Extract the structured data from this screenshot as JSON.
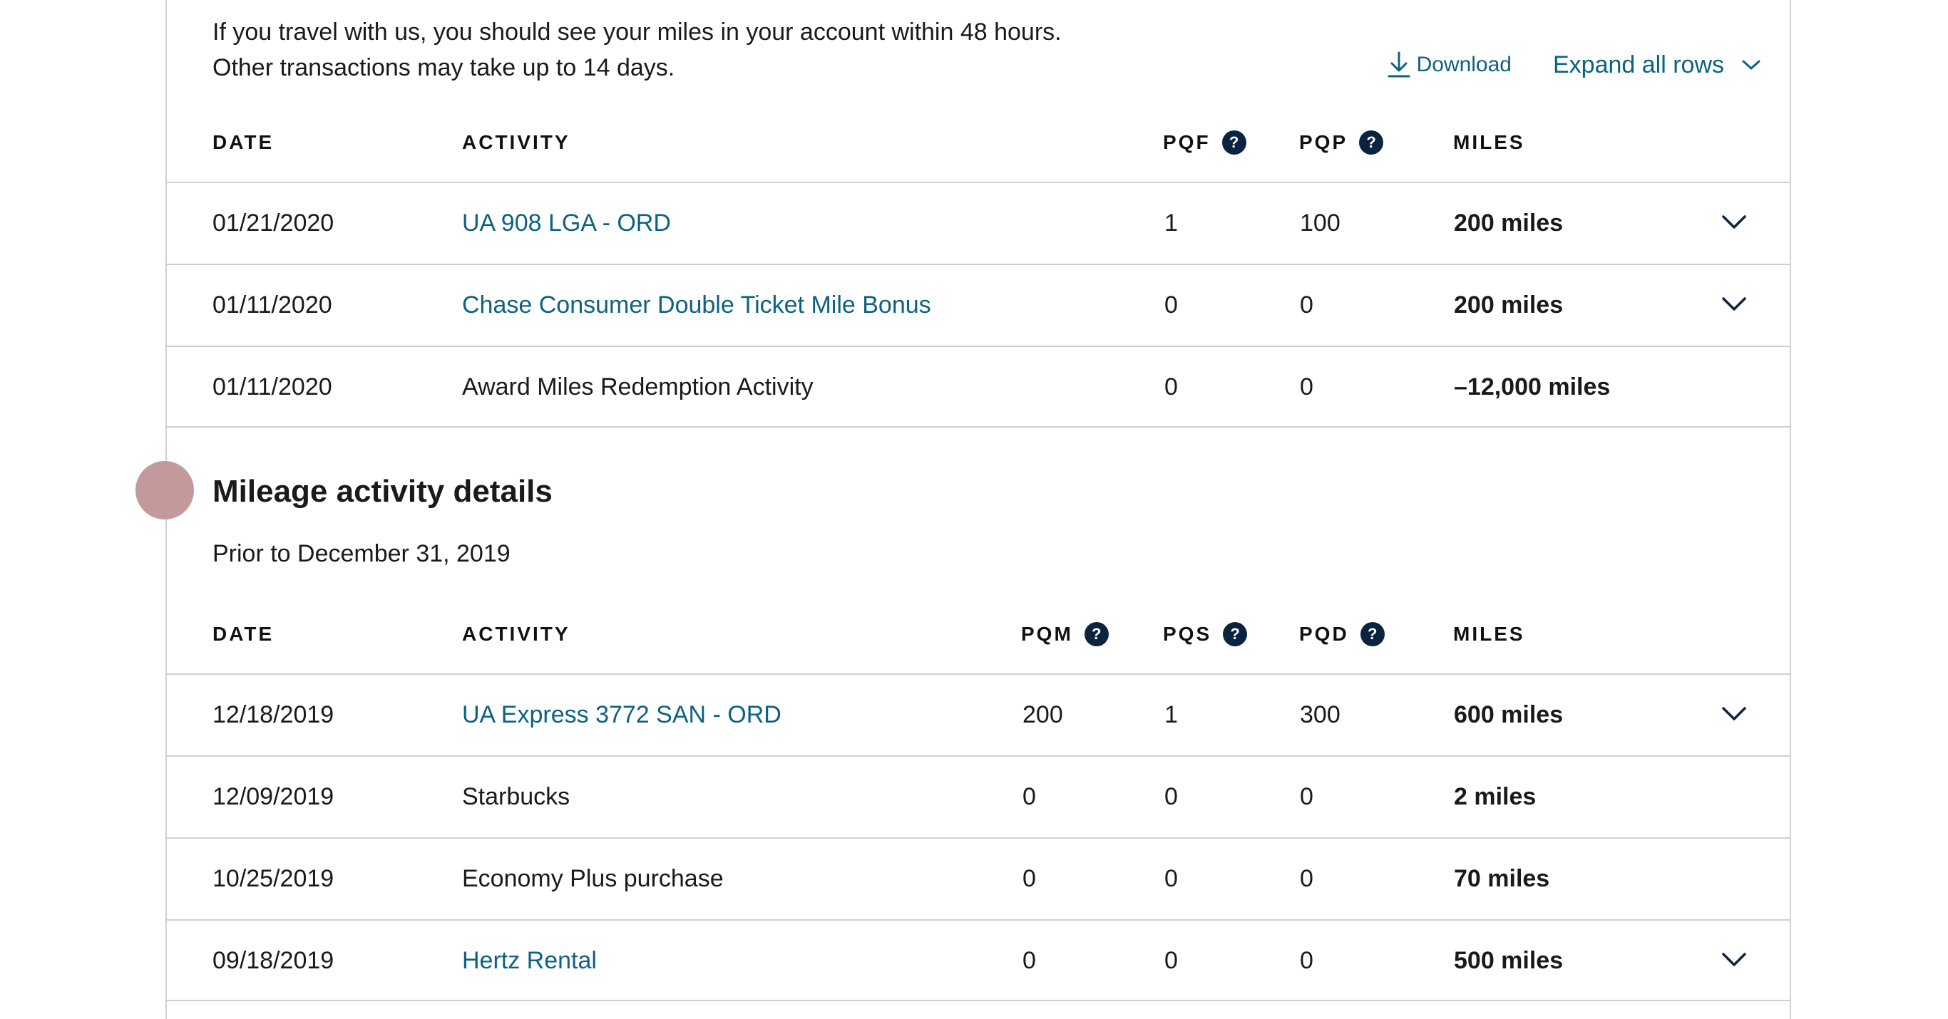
{
  "intro": {
    "line1": "If you travel with us, you should see your miles in your account within 48 hours.",
    "line2": "Other transactions may take up to 14 days."
  },
  "toolbar": {
    "download_label": "Download",
    "expand_label": "Expand all rows"
  },
  "recent": {
    "headers": {
      "date": "DATE",
      "activity": "ACTIVITY",
      "pqf": "PQF",
      "pqp": "PQP",
      "miles": "MILES"
    },
    "rows": [
      {
        "date": "01/21/2020",
        "activity": "UA 908 LGA - ORD",
        "link": true,
        "pqf": "1",
        "pqp": "100",
        "miles": "200 miles",
        "expandable": true
      },
      {
        "date": "01/11/2020",
        "activity": "Chase Consumer Double Ticket Mile Bonus",
        "link": true,
        "pqf": "0",
        "pqp": "0",
        "miles": "200 miles",
        "expandable": true
      },
      {
        "date": "01/11/2020",
        "activity": "Award Miles Redemption Activity",
        "link": false,
        "pqf": "0",
        "pqp": "0",
        "miles": "–12,000 miles",
        "expandable": false
      }
    ]
  },
  "details": {
    "title": "Mileage activity details",
    "subtitle": "Prior to December 31, 2019",
    "headers": {
      "date": "DATE",
      "activity": "ACTIVITY",
      "pqm": "PQM",
      "pqs": "PQS",
      "pqd": "PQD",
      "miles": "MILES"
    },
    "rows": [
      {
        "date": "12/18/2019",
        "activity": "UA Express 3772 SAN - ORD",
        "link": true,
        "pqm": "200",
        "pqs": "1",
        "pqd": "300",
        "miles": "600 miles",
        "expandable": true
      },
      {
        "date": "12/09/2019",
        "activity": "Starbucks",
        "link": false,
        "pqm": "0",
        "pqs": "0",
        "pqd": "0",
        "miles": "2 miles",
        "expandable": false
      },
      {
        "date": "10/25/2019",
        "activity": "Economy Plus purchase",
        "link": false,
        "pqm": "0",
        "pqs": "0",
        "pqd": "0",
        "miles": "70 miles",
        "expandable": false
      },
      {
        "date": "09/18/2019",
        "activity": "Hertz Rental",
        "link": true,
        "pqm": "0",
        "pqs": "0",
        "pqd": "0",
        "miles": "500 miles",
        "expandable": true
      }
    ]
  },
  "help_glyph": "?",
  "colors": {
    "link": "#0c6280",
    "help_badge": "#0b2340",
    "border": "#cfcfcf",
    "cursor_dot": "#c4999c"
  }
}
